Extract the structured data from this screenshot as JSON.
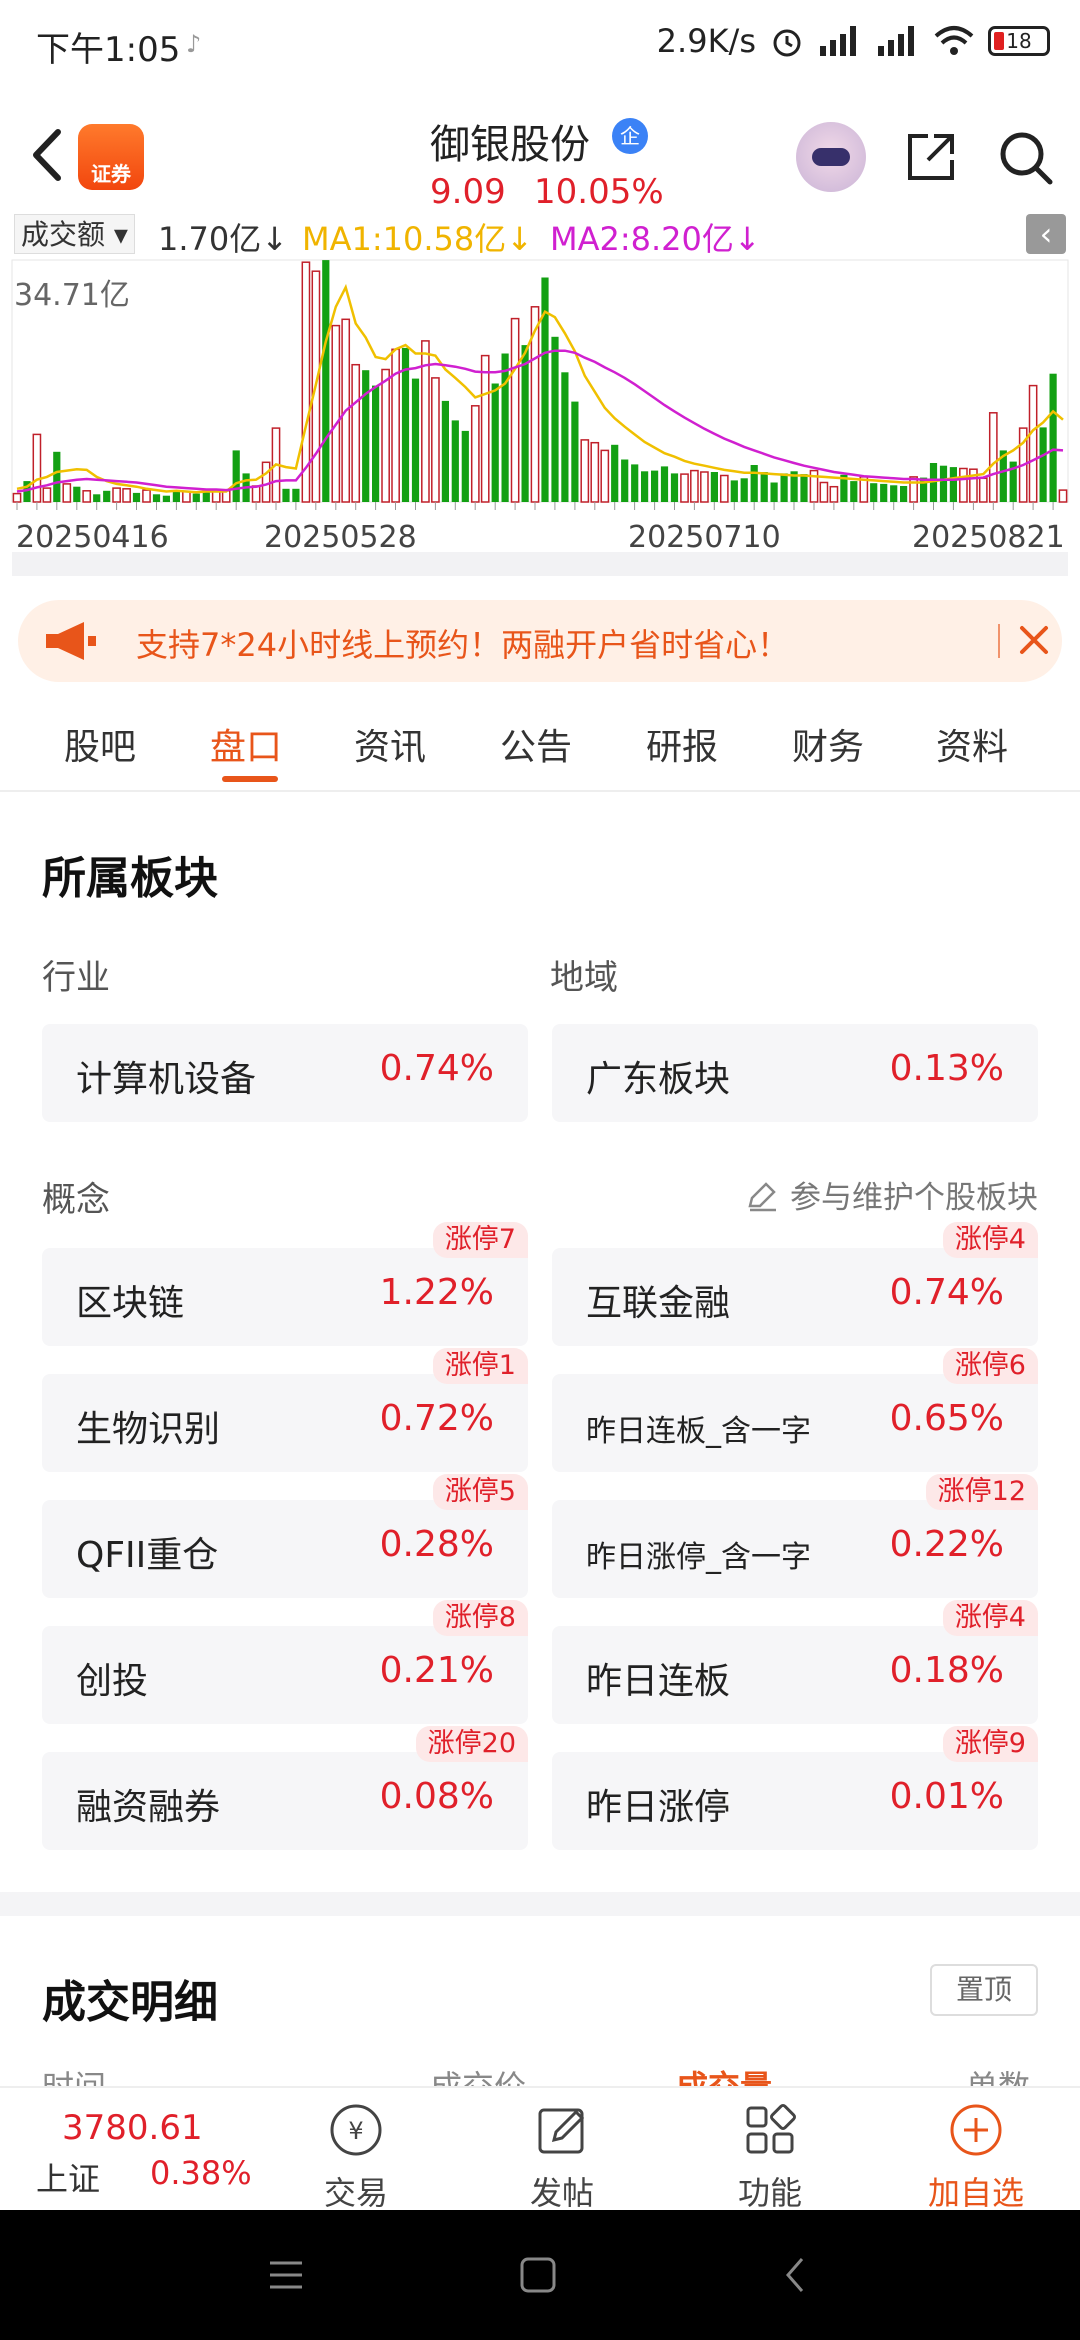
{
  "status_bar": {
    "time": "下午1:05",
    "net_speed": "2.9K/s",
    "battery": "18"
  },
  "header": {
    "logo_text": "证券",
    "stock_name": "御银股份",
    "badge": "企",
    "price": "9.09",
    "change_pct": "10.05%"
  },
  "chart_data": {
    "type": "bar",
    "indicator": "成交额",
    "current_label": "1.70亿",
    "ma1_label": "MA1:10.58亿",
    "ma2_label": "MA2:8.20亿",
    "max_label": "34.71亿",
    "x_tick_labels": [
      "20250416",
      "20250528",
      "20250710",
      "20250821"
    ],
    "ylim": [
      0,
      34.71
    ],
    "unit": "亿",
    "colors": {
      "up": "#c0202a",
      "down": "#13a013",
      "ma1": "#f0c000",
      "ma2": "#d020d0"
    },
    "series": [
      {
        "dir": [
          1,
          0,
          1,
          1,
          0,
          1,
          0,
          1,
          0,
          0,
          1,
          1,
          0,
          1,
          0,
          0,
          0,
          1,
          0,
          0,
          1,
          1,
          0,
          0,
          1,
          1,
          1,
          0,
          0,
          1,
          1,
          0,
          1,
          1,
          1,
          0,
          0,
          1,
          1,
          0,
          0,
          1,
          1,
          0,
          0,
          0,
          1,
          1,
          0,
          0,
          1,
          0,
          1,
          0,
          0,
          0,
          0,
          1,
          1,
          1,
          0,
          0,
          0,
          0,
          0,
          0,
          0,
          1,
          1,
          1,
          0,
          1,
          0,
          0,
          0,
          0,
          0,
          0,
          0,
          0,
          1,
          1,
          1,
          0,
          0,
          1,
          0,
          0,
          0,
          0,
          1,
          0,
          0,
          0,
          0,
          1,
          1,
          1,
          1,
          0,
          0,
          1,
          1,
          0,
          0,
          1,
          1
        ],
        "values": [
          1.2,
          3.0,
          9.7,
          2.0,
          7.2,
          2.6,
          2.2,
          1.6,
          1.1,
          1.6,
          2.0,
          1.9,
          1.3,
          1.7,
          1.1,
          0.9,
          1.5,
          1.5,
          1.2,
          1.4,
          1.6,
          1.6,
          7.4,
          4.1,
          2.3,
          5.7,
          10.6,
          1.9,
          1.9,
          34.4,
          33.1,
          34.7,
          25.3,
          26.2,
          19.7,
          18.9,
          16.7,
          19.0,
          21.9,
          22.1,
          17.7,
          23.1,
          17.8,
          14.5,
          11.7,
          10.2,
          13.8,
          21.0,
          17.0,
          21.3,
          26.3,
          22.5,
          28.0,
          32.2,
          23.7,
          18.6,
          14.4,
          8.9,
          8.5,
          7.4,
          8.2,
          6.1,
          5.4,
          4.4,
          4.5,
          5.1,
          4.1,
          4.0,
          4.5,
          4.3,
          4.3,
          3.8,
          3.1,
          3.4,
          5.3,
          4.3,
          2.8,
          4.1,
          4.4,
          4.0,
          4.5,
          2.8,
          2.2,
          3.9,
          3.0,
          3.6,
          2.7,
          2.6,
          2.4,
          2.3,
          3.6,
          3.5,
          5.6,
          5.2,
          5.0,
          4.8,
          4.7,
          3.4,
          12.8,
          7.4,
          5.8,
          10.6,
          16.7,
          10.7,
          18.4,
          1.7
        ]
      },
      {
        "name": "MA1",
        "values": [
          1.9,
          2.2,
          3.2,
          3.6,
          4.3,
          4.5,
          4.7,
          4.6,
          3.6,
          3.0,
          2.6,
          2.4,
          2.2,
          1.9,
          1.7,
          1.5,
          1.6,
          1.5,
          1.4,
          1.5,
          1.5,
          1.5,
          2.7,
          3.1,
          3.2,
          4.1,
          5.4,
          5.0,
          4.8,
          10.9,
          16.8,
          23.0,
          28.0,
          30.8,
          25.6,
          23.6,
          20.8,
          20.5,
          21.9,
          22.5,
          21.3,
          21.3,
          21.0,
          19.0,
          17.8,
          16.5,
          15.0,
          15.5,
          16.0,
          17.0,
          19.1,
          21.4,
          24.6,
          27.3,
          26.5,
          24.2,
          21.6,
          18.1,
          15.8,
          13.5,
          12.0,
          10.8,
          9.7,
          8.6,
          7.8,
          7.0,
          6.5,
          5.9,
          5.5,
          5.2,
          4.9,
          4.6,
          4.4,
          4.2,
          4.2,
          4.1,
          4.0,
          3.9,
          3.8,
          3.8,
          3.7,
          3.6,
          3.5,
          3.4,
          3.3,
          3.2,
          3.1,
          3.0,
          2.9,
          2.8,
          2.8,
          2.8,
          3.0,
          3.2,
          3.4,
          3.6,
          3.8,
          4.0,
          5.5,
          6.6,
          7.4,
          8.5,
          10.3,
          11.4,
          13.0,
          11.8
        ]
      },
      {
        "name": "MA2",
        "values": [
          1.5,
          1.7,
          2.1,
          2.4,
          2.8,
          3.0,
          3.2,
          3.3,
          3.2,
          3.1,
          3.0,
          2.9,
          2.8,
          2.6,
          2.4,
          2.2,
          2.1,
          2.0,
          1.9,
          1.8,
          1.8,
          1.7,
          1.9,
          2.1,
          2.2,
          2.5,
          3.0,
          3.1,
          3.1,
          4.9,
          6.9,
          9.1,
          11.1,
          13.1,
          14.3,
          15.5,
          16.5,
          17.4,
          18.4,
          19.0,
          19.2,
          19.6,
          19.8,
          19.6,
          19.4,
          19.1,
          18.7,
          18.6,
          18.6,
          18.8,
          19.3,
          19.8,
          20.6,
          21.4,
          21.7,
          21.7,
          21.4,
          20.7,
          20.1,
          19.3,
          18.6,
          17.8,
          16.9,
          15.9,
          14.9,
          13.9,
          13.0,
          12.1,
          11.3,
          10.5,
          9.8,
          9.1,
          8.5,
          7.9,
          7.4,
          6.9,
          6.4,
          6.0,
          5.6,
          5.2,
          4.9,
          4.6,
          4.3,
          4.1,
          3.9,
          3.7,
          3.6,
          3.5,
          3.4,
          3.3,
          3.3,
          3.2,
          3.2,
          3.2,
          3.2,
          3.3,
          3.4,
          3.5,
          4.0,
          4.4,
          4.8,
          5.3,
          6.0,
          6.7,
          7.5,
          7.4
        ]
      }
    ]
  },
  "promo": {
    "text": "支持7*24小时线上预约！两融开户省时省心！"
  },
  "tabs": [
    "股吧",
    "盘口",
    "资讯",
    "公告",
    "研报",
    "财务",
    "资料"
  ],
  "sectors": {
    "title": "所属板块",
    "industry_label": "行业",
    "region_label": "地域",
    "industry": {
      "name": "计算机设备",
      "pct": "0.74%"
    },
    "region": {
      "name": "广东板块",
      "pct": "0.13%"
    },
    "concept_label": "概念",
    "maintain_label": "参与维护个股板块",
    "concepts": [
      {
        "name": "区块链",
        "pct": "1.22%",
        "tag": "涨停7"
      },
      {
        "name": "互联金融",
        "pct": "0.74%",
        "tag": "涨停4"
      },
      {
        "name": "生物识别",
        "pct": "0.72%",
        "tag": "涨停1"
      },
      {
        "name": "昨日连板_含一字",
        "pct": "0.65%",
        "tag": "涨停6"
      },
      {
        "name": "QFII重仓",
        "pct": "0.28%",
        "tag": "涨停5"
      },
      {
        "name": "昨日涨停_含一字",
        "pct": "0.22%",
        "tag": "涨停12"
      },
      {
        "name": "创投",
        "pct": "0.21%",
        "tag": "涨停8"
      },
      {
        "name": "昨日连板",
        "pct": "0.18%",
        "tag": "涨停4"
      },
      {
        "name": "融资融券",
        "pct": "0.08%",
        "tag": "涨停20"
      },
      {
        "name": "昨日涨停",
        "pct": "0.01%",
        "tag": "涨停9"
      }
    ]
  },
  "detail": {
    "title": "成交明细",
    "pin": "置顶",
    "col_time": "时间",
    "col_price": "成交价",
    "col_volume": "成交量",
    "col_count": "单数"
  },
  "bottom_bar": {
    "index_value": "3780.61",
    "index_name": "上证",
    "index_pct": "0.38%",
    "trade": "交易",
    "post": "发帖",
    "functions": "功能",
    "add": "加自选"
  }
}
